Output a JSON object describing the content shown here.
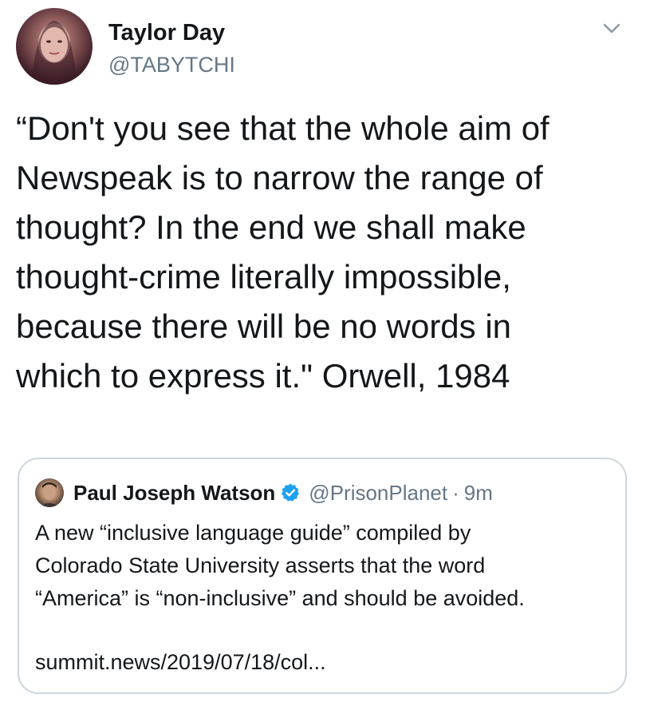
{
  "tweet": {
    "author": {
      "display_name": "Taylor Day",
      "handle": "@TABYTCHI"
    },
    "lines": [
      "“Don't you see that the whole aim of",
      "Newspeak is to narrow the range of",
      "thought? In the end we shall make",
      "thought-crime literally impossible,",
      "because there will be no words in",
      "which to express it.\" Orwell, 1984"
    ],
    "menu_icon": "chevron-down-icon"
  },
  "quoted_tweet": {
    "display_name": "Paul Joseph Watson",
    "verified": true,
    "verified_color": "#1da1f2",
    "handle": "@PrisonPlanet",
    "separator": "·",
    "time": "9m",
    "lines": [
      "A new “inclusive language guide” compiled by",
      "Colorado State University asserts that the word",
      "“America” is “non-inclusive” and should be avoided."
    ],
    "link": "summit.news/2019/07/18/col..."
  },
  "colors": {
    "text": "#14171a",
    "secondary": "#657786",
    "border": "#ccd6dd"
  }
}
